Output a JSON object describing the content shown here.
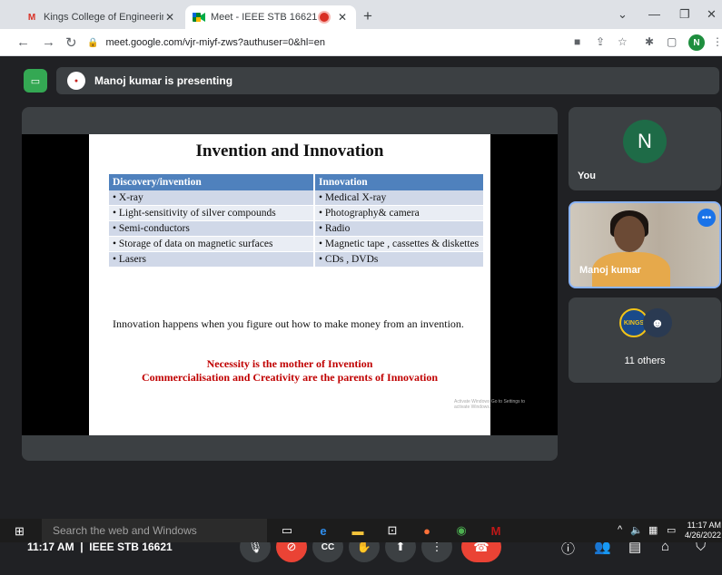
{
  "browser": {
    "tabs": [
      {
        "title": "Kings College of Engineering Ma",
        "favicon": "gmail-icon",
        "active": false
      },
      {
        "title": "Meet - IEEE STB 16621",
        "favicon": "meet-icon",
        "active": true
      }
    ],
    "url": "meet.google.com/vjr-miyf-zws?authuser=0&hl=en",
    "profile_initial": "N"
  },
  "meet": {
    "presenting_text": "Manoj kumar is presenting",
    "slide": {
      "title": "Invention and Innovation",
      "table_headers": [
        "Discovery/invention",
        "Innovation"
      ],
      "table_rows": [
        [
          "• X-ray",
          "• Medical X-ray"
        ],
        [
          "• Light-sensitivity of silver compounds",
          "• Photography& camera"
        ],
        [
          "• Semi-conductors",
          "• Radio"
        ],
        [
          "• Storage of data on magnetic surfaces",
          "• Magnetic tape , cassettes & diskettes"
        ],
        [
          "• Lasers",
          "• CDs , DVDs"
        ]
      ],
      "paragraph": "Innovation happens when you figure out how to make money from an invention.",
      "quote_line1": "Necessity is the mother of Invention",
      "quote_line2": "Commercialisation and Creativity are the parents of Innovation",
      "watermark": "Activate Windows Go to Settings to activate Windows."
    },
    "tiles": {
      "you_initial": "N",
      "you_label": "You",
      "speaker_name": "Manoj kumar",
      "others_label": "11 others",
      "others_logo_text": "KINGS"
    },
    "bottom": {
      "clock": "11:17 AM",
      "separator": "|",
      "meeting_name": "IEEE STB 16621",
      "participants_count": "14"
    }
  },
  "taskbar": {
    "search_placeholder": "Search the web and Windows",
    "time": "11:17 AM",
    "date": "4/26/2022"
  },
  "colors": {
    "meet_bg": "#202124",
    "tile_bg": "#3c4043",
    "leave_red": "#ea4335",
    "present_green": "#34a853",
    "slide_header_blue": "#4f81bd",
    "quote_red": "#c00000"
  }
}
